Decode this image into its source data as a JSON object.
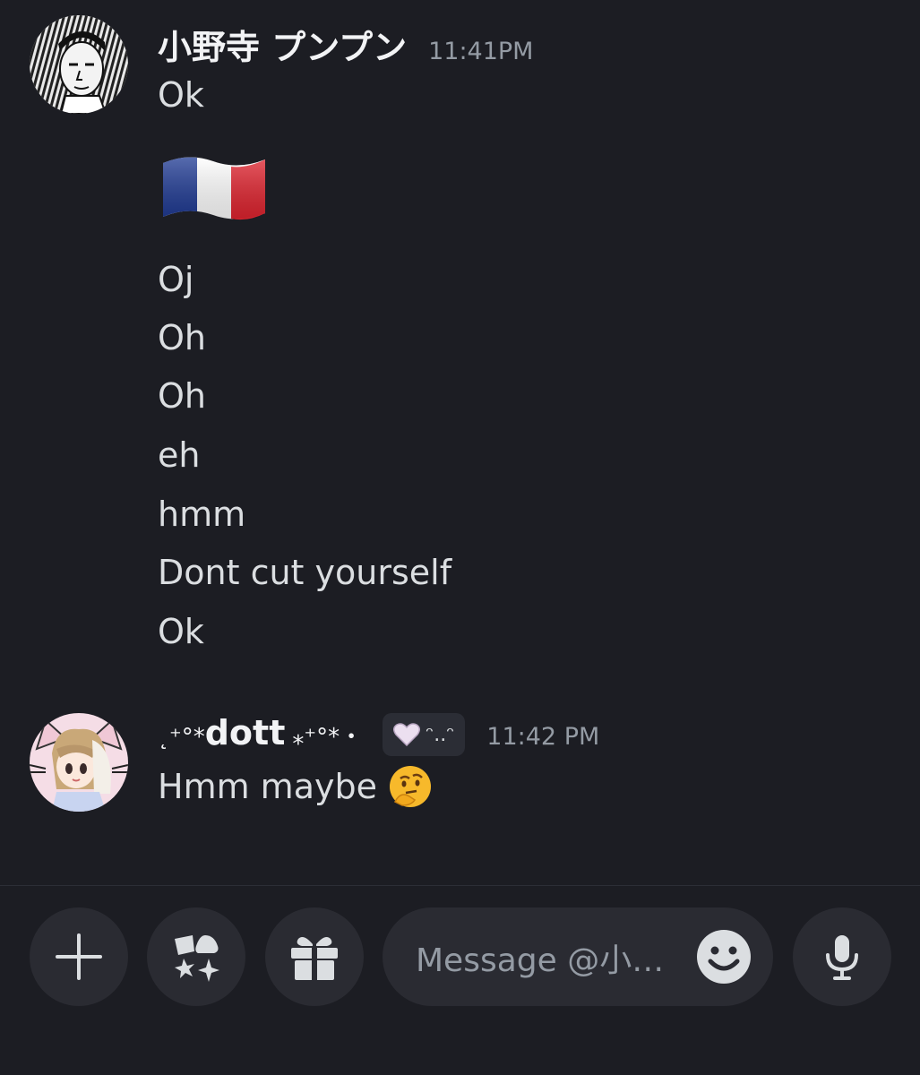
{
  "messages": [
    {
      "author": "小野寺 プンプン",
      "timestamp": "11:41PM",
      "avatar_icon": "manga-portrait-avatar",
      "lines": [
        "Ok",
        "Oj",
        "Oh",
        "Oh",
        "eh",
        "hmm",
        "Dont cut yourself",
        "Ok"
      ],
      "emoji": "flag-france-emoji"
    },
    {
      "author_prefix": "˛⁺°*",
      "author": "dott",
      "author_suffix": "⁎⁺°*・",
      "timestamp": "11:42 PM",
      "avatar_icon": "anime-cat-ear-avatar",
      "tag": {
        "icon": "heart-icon",
        "text": "ᵔ..ᵔ"
      },
      "text": "Hmm maybe",
      "emoji": "thinking-face-emoji"
    }
  ],
  "composer": {
    "placeholder": "Message @小…",
    "buttons": [
      "plus-icon",
      "apps-icon",
      "gift-icon",
      "emoji-icon",
      "microphone-icon"
    ]
  },
  "colors": {
    "background": "#1c1d23",
    "button_bg": "#2a2b32",
    "text": "#dbdee1",
    "muted": "#949ba4"
  }
}
